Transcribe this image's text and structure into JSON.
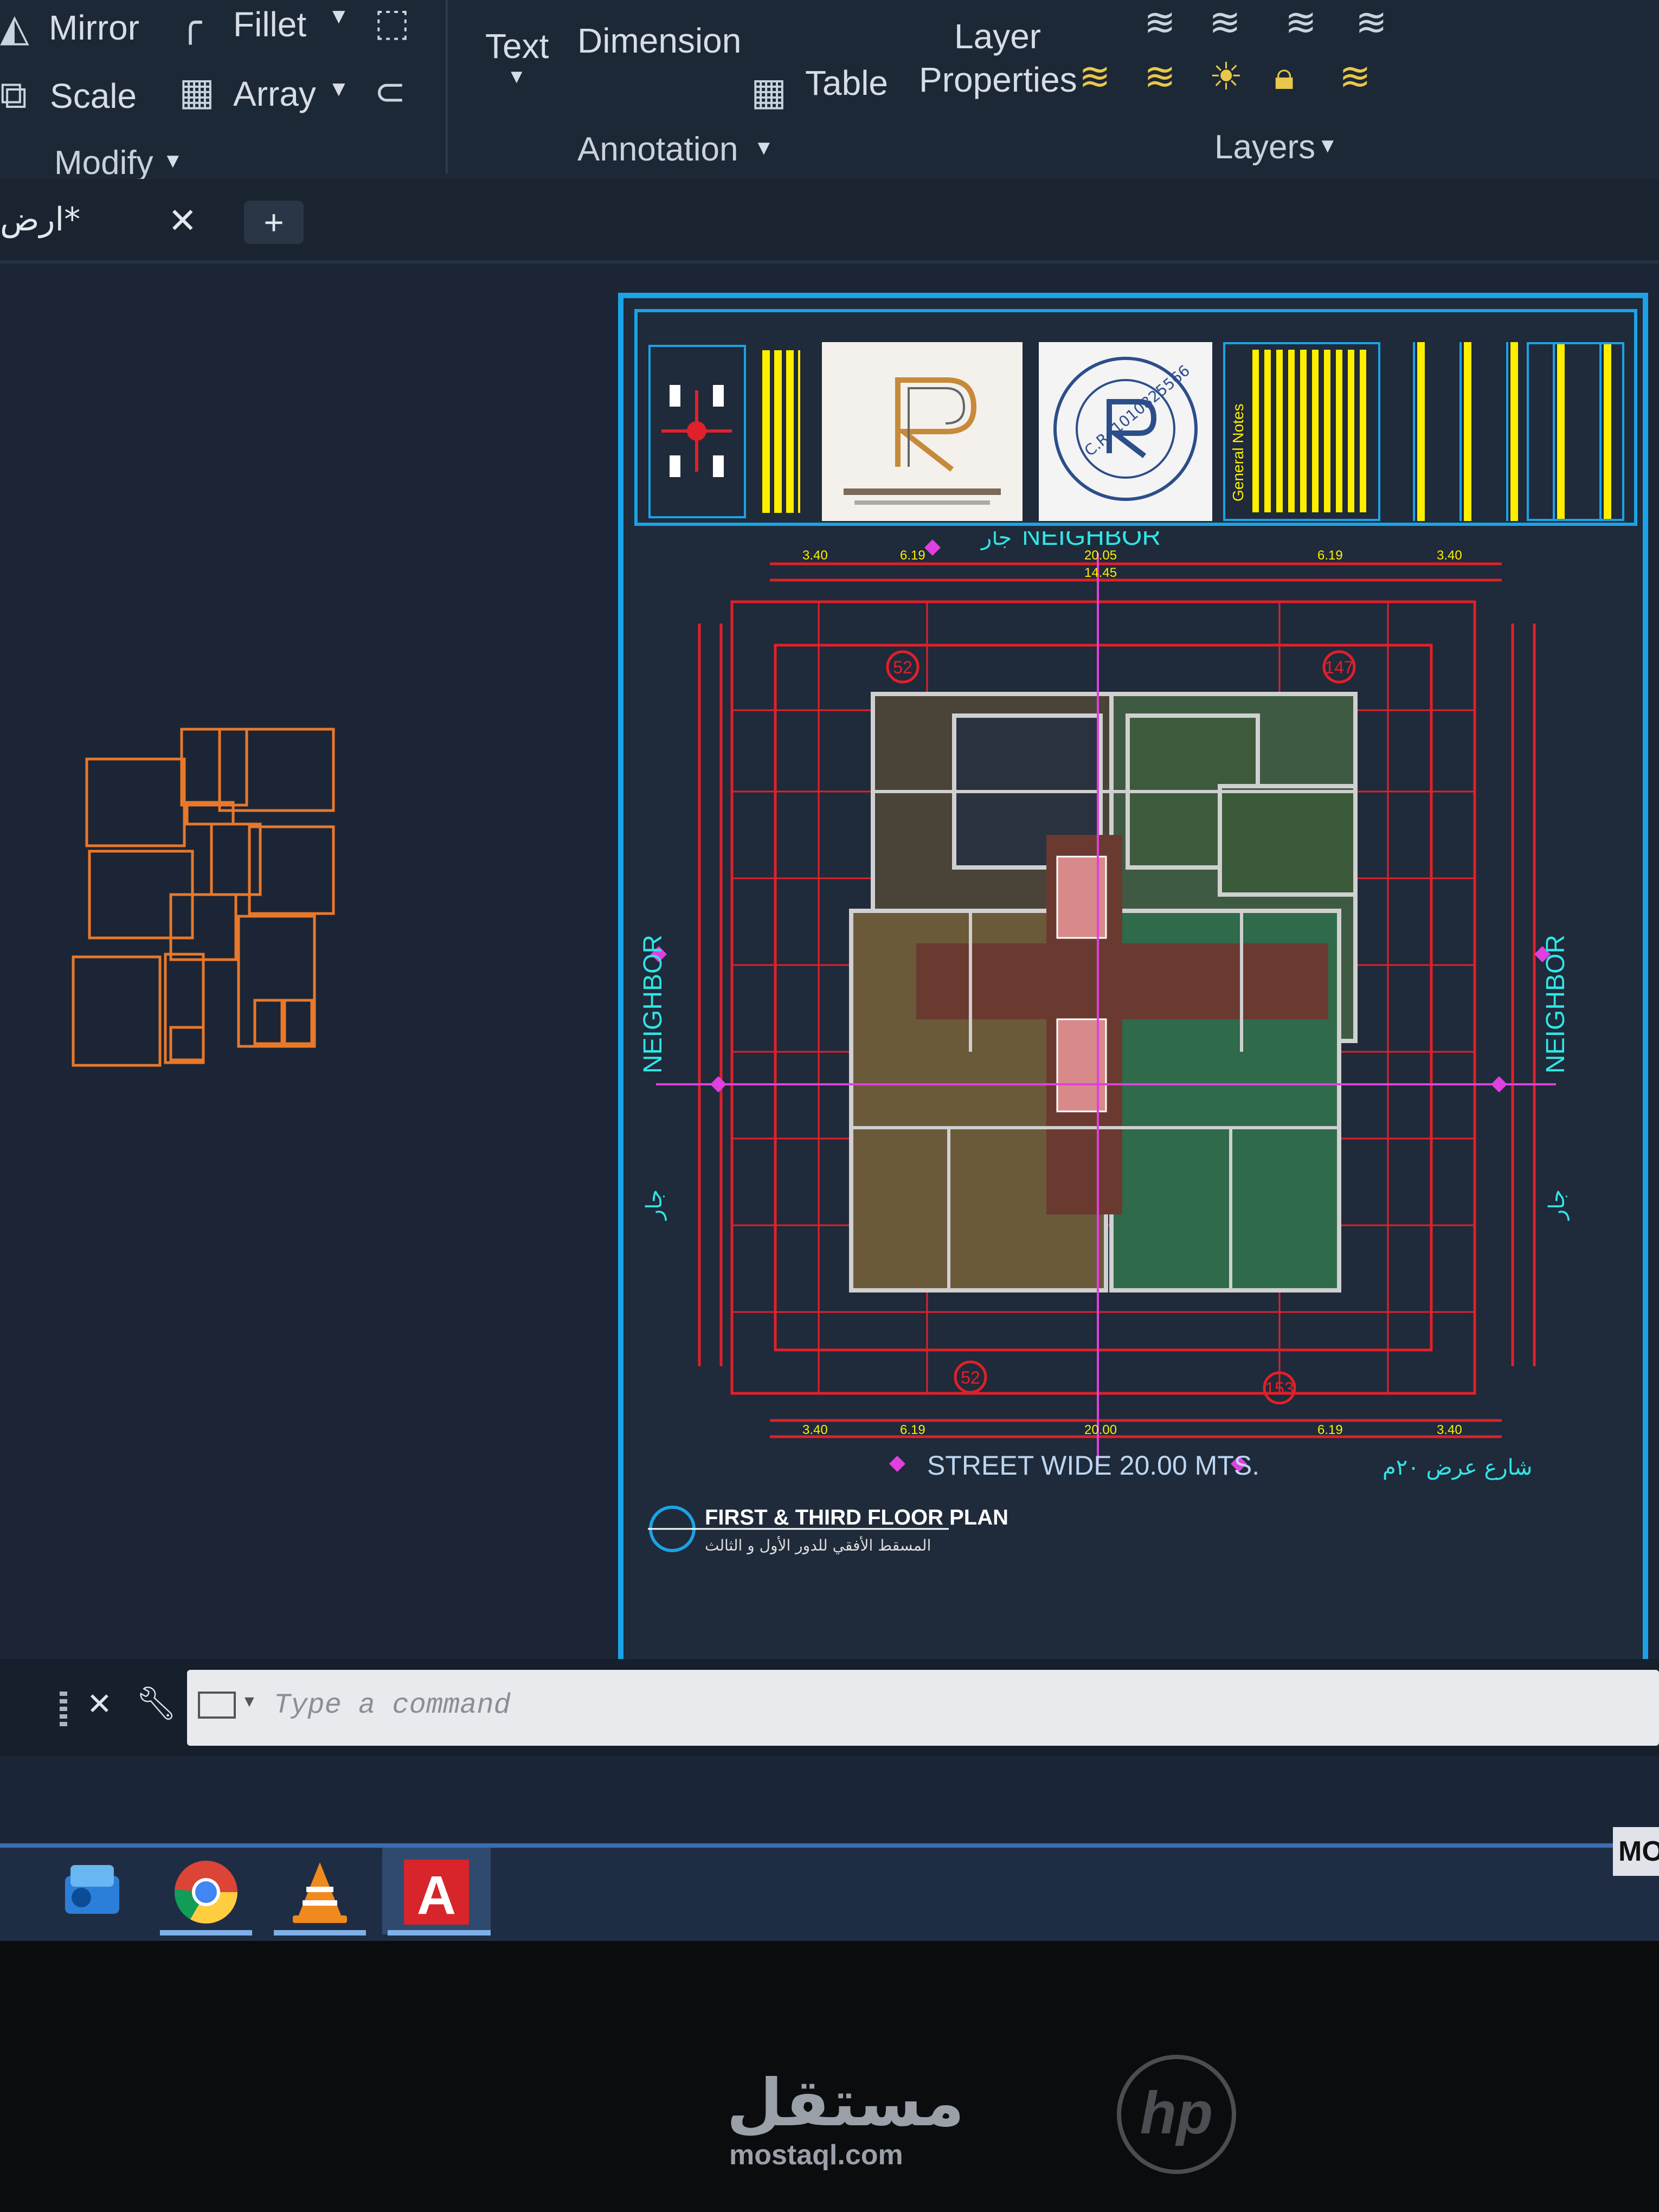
{
  "ribbon": {
    "modify": {
      "mirror_label": "Mirror",
      "fillet_label": "Fillet",
      "scale_label": "Scale",
      "array_label": "Array",
      "panel_label": "Modify"
    },
    "annotation": {
      "text_label": "Text",
      "dimension_label": "Dimension",
      "table_label": "Table",
      "panel_label": "Annotation"
    },
    "layers": {
      "layer_properties_label_line1": "Layer",
      "layer_properties_label_line2": "Properties",
      "panel_label": "Layers"
    }
  },
  "tabs": {
    "active_tab_label": "ارض*"
  },
  "drawing": {
    "neighbor_top": "NEIGHBOR",
    "neighbor_top_ar": "جار",
    "neighbor_left": "NEIGHBOR",
    "neighbor_left_ar": "جار",
    "neighbor_right": "NEIGHBOR",
    "neighbor_right_ar": "جار",
    "street_label": "STREET  WIDE  20.00  MTS.",
    "street_label_ar": "شارع عرض ٢٠م",
    "plan_title": "FIRST & THIRD  FLOOR PLAN",
    "plan_subtitle_ar": "المسقط الأفقي للدور الأول و الثالث",
    "stamp_text": "C.R. 1010825566",
    "title_block_note": "General Notes",
    "grid_bubbles": [
      "52",
      "147",
      "52",
      "153"
    ],
    "top_dims": [
      "3.40",
      "6.19",
      "20.05",
      "14.45",
      "6.19",
      "3.40"
    ],
    "bottom_dims": [
      "3.40",
      "6.19",
      "20.00",
      "6.19",
      "3.40"
    ]
  },
  "command_line": {
    "placeholder": "Type a command"
  },
  "taskbar": {
    "items": [
      "outlook-icon",
      "chrome-icon",
      "vlc-icon",
      "autocad-icon"
    ],
    "corner_label": "MO"
  },
  "watermark": {
    "brand_ar": "مستقل",
    "brand_url": "mostaql.com",
    "laptop_logo": "hp"
  },
  "colors": {
    "ribbon_bg": "#1d2836",
    "model_bg": "#1b2535",
    "sheet_border": "#1aa3e6",
    "dimension_red": "#e0202a",
    "neighbor_text": "#2fe6e6",
    "sketch_orange": "#e8782a",
    "annotation_yellow": "#ffee00",
    "taskbar_accent": "#3a6fb0"
  }
}
